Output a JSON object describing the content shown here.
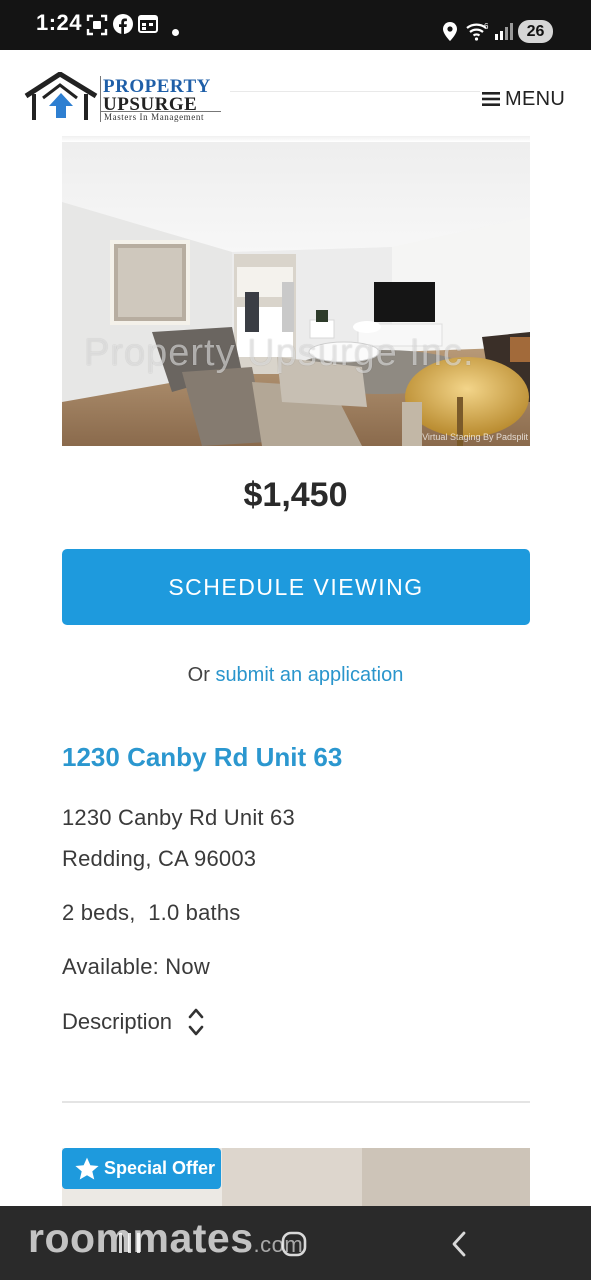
{
  "status_bar": {
    "time": "1:24",
    "battery": "26"
  },
  "header": {
    "logo_line1": "PROPERTY",
    "logo_line2": "UPSURGE",
    "logo_tagline": "Masters In Management",
    "menu_label": "MENU"
  },
  "photo": {
    "watermark": "Property Upsurge Inc.",
    "credit": "Virtual Staging By Padsplit"
  },
  "listing": {
    "price": "$1,450",
    "schedule_label": "SCHEDULE VIEWING",
    "apply_prefix": "Or ",
    "apply_link": "submit an application",
    "title": "1230 Canby Rd Unit 63",
    "address_line1": "1230 Canby Rd Unit 63",
    "address_line2": "Redding, CA 96003",
    "beds_baths": "2 beds,  1.0 baths",
    "availability": "Available: Now",
    "description_label": "Description"
  },
  "next_listing": {
    "badge": "Special Offer"
  },
  "nav": {
    "brand": "roommates",
    "brand_suffix": ".com"
  },
  "colors": {
    "accent": "#1e9add",
    "link": "#2a95cc",
    "logo_blue": "#1f5fa8"
  }
}
